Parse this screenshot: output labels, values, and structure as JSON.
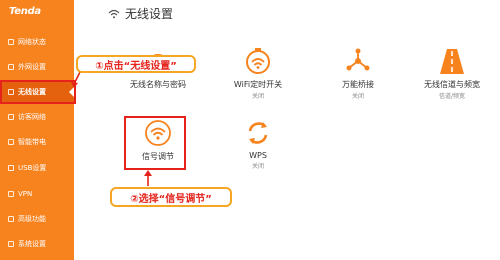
{
  "sidebar": {
    "logo": "Tenda",
    "items": [
      {
        "label": "网络状态",
        "icon": "network-status-icon"
      },
      {
        "label": "外网设置",
        "icon": "wan-settings-icon"
      },
      {
        "label": "无线设置",
        "icon": "wifi-icon",
        "active": true
      },
      {
        "label": "访客网络",
        "icon": "guest-network-icon"
      },
      {
        "label": "智能带电",
        "icon": "smart-power-icon"
      },
      {
        "label": "USB设置",
        "icon": "usb-icon"
      },
      {
        "label": "VPN",
        "icon": "vpn-icon"
      },
      {
        "label": "高级功能",
        "icon": "advanced-icon"
      },
      {
        "label": "系统设置",
        "icon": "system-settings-icon"
      }
    ]
  },
  "header": {
    "title": "无线设置",
    "icon": "wifi-icon"
  },
  "tiles": [
    {
      "label": "无线名称与密码",
      "sub": "",
      "icon": "wifi-icon"
    },
    {
      "label": "WiFi定时开关",
      "sub": "关闭",
      "icon": "wifi-timer-icon"
    },
    {
      "label": "万能桥接",
      "sub": "关闭",
      "icon": "bridge-icon"
    },
    {
      "label": "无线信道与频宽",
      "sub": "信道/频宽",
      "icon": "road-icon"
    },
    {
      "label": "信号调节",
      "sub": "",
      "icon": "signal-adjust-icon"
    },
    {
      "label": "WPS",
      "sub": "关闭",
      "icon": "wps-icon"
    }
  ],
  "annotations": {
    "step1": "①点击“无线设置”",
    "step2": "②选择“信号调节”"
  },
  "colors": {
    "brand": "#f7831f",
    "active": "#e4620d",
    "highlight": "#e5231a",
    "callout_border": "#f5a623"
  }
}
